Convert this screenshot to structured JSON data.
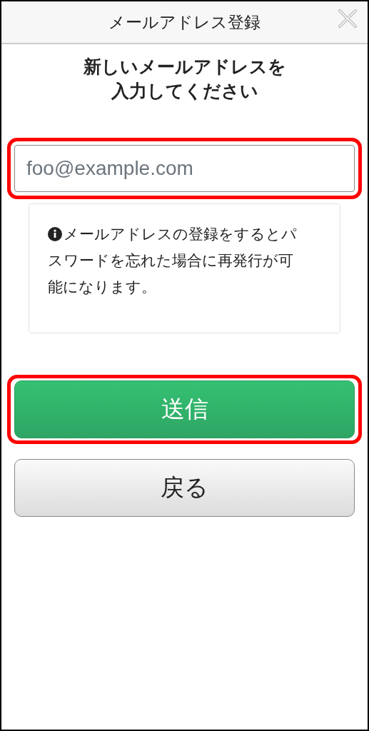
{
  "header": {
    "title": "メールアドレス登録"
  },
  "heading": [
    "新しいメールアドレスを",
    "入力してください"
  ],
  "email_field": {
    "placeholder": "foo@example.com",
    "highlighted": true
  },
  "notice": {
    "text": "メールアドレスの登録をするとパスワードを忘れた場合に再発行が可能になります。"
  },
  "buttons": [
    {
      "label": "送信",
      "kind": "primary",
      "highlighted": true
    },
    {
      "label": "戻る",
      "kind": "secondary",
      "highlighted": false
    }
  ]
}
